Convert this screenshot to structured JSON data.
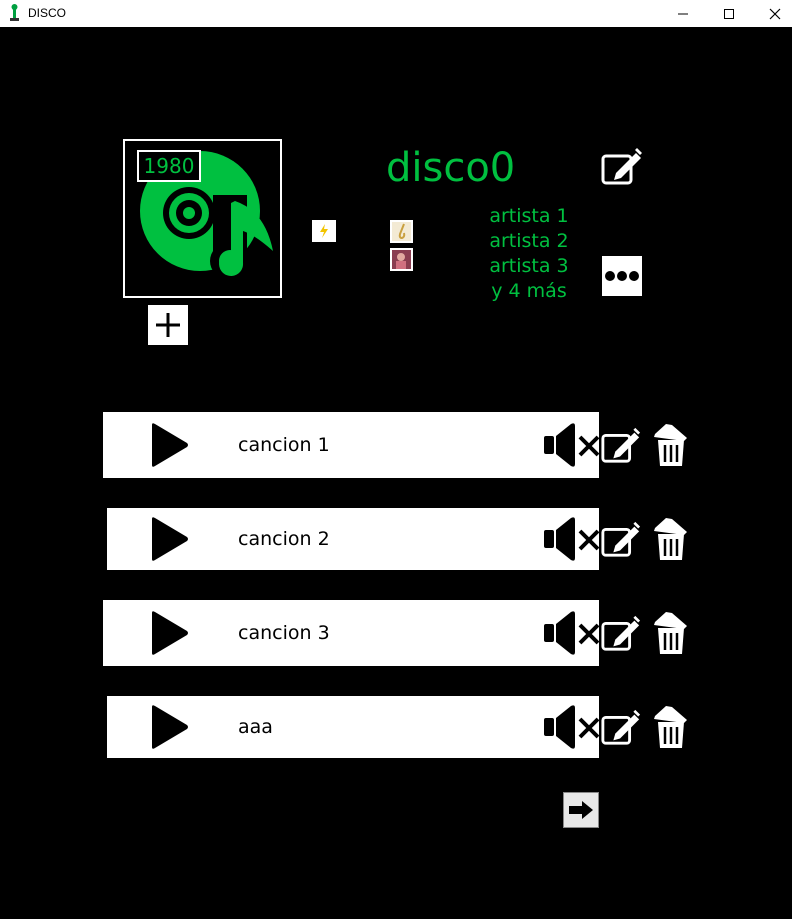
{
  "window": {
    "title": "DISCO"
  },
  "album": {
    "year": "1980",
    "title": "disco0",
    "artists": [
      "artista 1",
      "artista 2",
      "artista 3",
      "y 4 más"
    ]
  },
  "songs": [
    {
      "name": "cancion 1"
    },
    {
      "name": "cancion 2"
    },
    {
      "name": "cancion 3"
    },
    {
      "name": "aaa"
    }
  ],
  "colors": {
    "accent": "#00c040",
    "background": "#000000",
    "row": "#ffffff"
  },
  "icons": {
    "cover": "vinyl-music-note-icon",
    "add": "plus-icon",
    "genre": "lightning-icon",
    "edit": "pencil-edit-icon",
    "more": "ellipsis-icon",
    "play": "play-icon",
    "mute": "speaker-muted-icon",
    "delete": "trash-icon",
    "next": "arrow-right-icon"
  }
}
